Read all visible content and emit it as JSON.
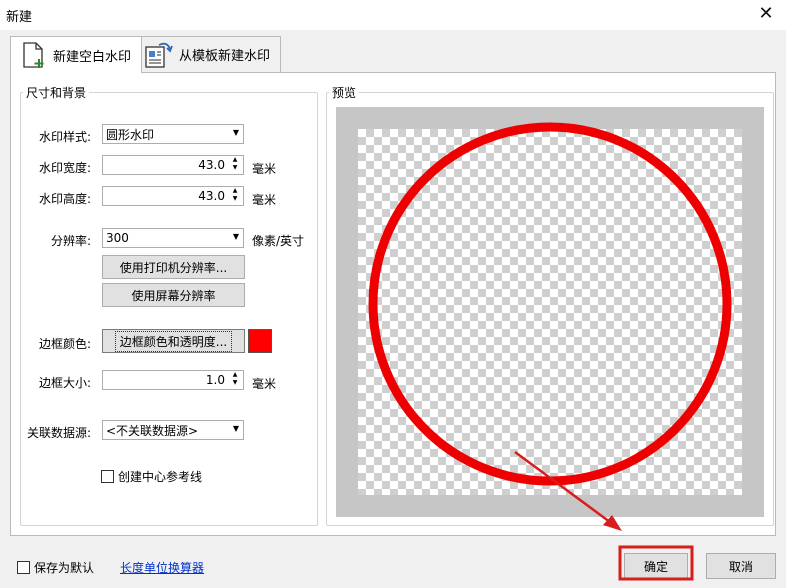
{
  "window": {
    "title": "新建",
    "close_glyph": "✕"
  },
  "tabs": [
    {
      "label": "新建空白水印",
      "icon": "new-document-icon",
      "active": true
    },
    {
      "label": "从模板新建水印",
      "icon": "template-icon",
      "active": false
    }
  ],
  "size_group": {
    "legend": "尺寸和背景",
    "style_label": "水印样式:",
    "style_value": "圆形水印",
    "width_label": "水印宽度:",
    "width_value": "43.0",
    "width_unit": "毫米",
    "height_label": "水印高度:",
    "height_value": "43.0",
    "height_unit": "毫米",
    "resolution_label": "分辨率:",
    "resolution_value": "300",
    "resolution_unit": "像素/英寸",
    "printer_res_button": "使用打印机分辨率...",
    "screen_res_button": "使用屏幕分辨率",
    "border_color_label": "边框颜色:",
    "border_color_button": "边框颜色和透明度...",
    "border_color": "#ff0000",
    "border_size_label": "边框大小:",
    "border_size_value": "1.0",
    "border_size_unit": "毫米",
    "datasource_label": "关联数据源:",
    "datasource_value": "<不关联数据源>",
    "center_guides_label": "创建中心参考线",
    "center_guides_checked": false
  },
  "preview_group": {
    "legend": "预览",
    "circle_color": "#ee0000"
  },
  "footer": {
    "save_default_label": "保存为默认",
    "save_default_checked": false,
    "unit_converter_link": "长度单位换算器",
    "ok_button": "确定",
    "cancel_button": "取消"
  },
  "annotation_color": "#d91c1c"
}
